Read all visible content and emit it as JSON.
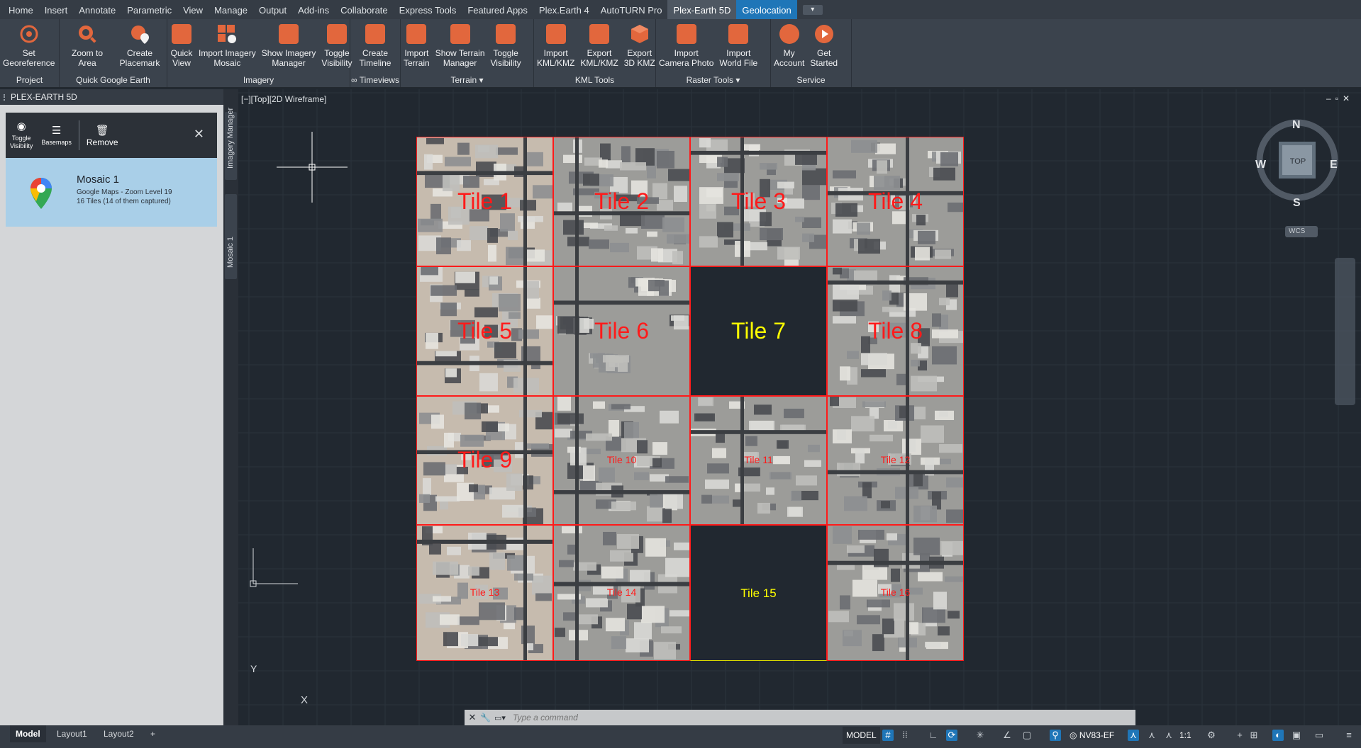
{
  "ribbon_tabs": [
    "Home",
    "Insert",
    "Annotate",
    "Parametric",
    "View",
    "Manage",
    "Output",
    "Add-ins",
    "Collaborate",
    "Express Tools",
    "Featured Apps",
    "Plex.Earth 4",
    "AutoTURN Pro",
    "Plex-Earth 5D",
    "Geolocation"
  ],
  "active_tab": "Plex-Earth 5D",
  "ribbon": {
    "project": {
      "title": "Project",
      "buttons": [
        "Set\nGeoreference"
      ]
    },
    "quick_google_earth": {
      "title": "Quick Google Earth",
      "buttons": [
        "Zoom to\nArea",
        "Create\nPlacemark"
      ]
    },
    "imagery": {
      "title": "Imagery",
      "buttons": [
        "Quick\nView",
        "Import Imagery\nMosaic",
        "Show Imagery\nManager",
        "Toggle\nVisibility"
      ]
    },
    "timeviews": {
      "title": "∞ Timeviews",
      "buttons": [
        "Create\nTimeline"
      ]
    },
    "terrain": {
      "title": "Terrain",
      "buttons": [
        "Import\nTerrain",
        "Show Terrain\nManager",
        "Toggle\nVisibility"
      ]
    },
    "kml_tools": {
      "title": "KML Tools",
      "buttons": [
        "Import\nKML/KMZ",
        "Export\nKML/KMZ",
        "Export\n3D KMZ"
      ]
    },
    "raster_tools": {
      "title": "Raster Tools",
      "buttons": [
        "Import\nCamera Photo",
        "Import\nWorld File"
      ]
    },
    "service": {
      "title": "Service",
      "buttons": [
        "My\nAccount",
        "Get\nStarted"
      ]
    }
  },
  "palette": {
    "title": "PLEX-EARTH 5D",
    "toolbar": {
      "toggle": "Toggle\nVisibility",
      "basemaps": "Basemaps",
      "remove": "Remove"
    },
    "mosaic": {
      "name": "Mosaic 1",
      "source": "Google Maps - Zoom Level 19",
      "tiles": "16 Tiles (14 of them captured)"
    },
    "side_tabs": [
      "Imagery Manager",
      "Mosaic 1"
    ]
  },
  "viewport": {
    "label": "[−][Top][2D Wireframe]",
    "tiles": [
      {
        "label": "Tile 1",
        "captured": true,
        "size": "large"
      },
      {
        "label": "Tile 2",
        "captured": true,
        "size": "large"
      },
      {
        "label": "Tile 3",
        "captured": true,
        "size": "large"
      },
      {
        "label": "Tile 4",
        "captured": true,
        "size": "large"
      },
      {
        "label": "Tile 5",
        "captured": true,
        "size": "large"
      },
      {
        "label": "Tile 6",
        "captured": true,
        "size": "large"
      },
      {
        "label": "Tile 7",
        "captured": false,
        "size": "large"
      },
      {
        "label": "Tile 8",
        "captured": true,
        "size": "large"
      },
      {
        "label": "Tile 9",
        "captured": true,
        "size": "large"
      },
      {
        "label": "Tile 10",
        "captured": true,
        "size": "small"
      },
      {
        "label": "Tile 11",
        "captured": true,
        "size": "small"
      },
      {
        "label": "Tile 12",
        "captured": true,
        "size": "small"
      },
      {
        "label": "Tile 13",
        "captured": true,
        "size": "small"
      },
      {
        "label": "Tile 14",
        "captured": true,
        "size": "small"
      },
      {
        "label": "Tile 15",
        "captured": false,
        "size": "small"
      },
      {
        "label": "Tile 16",
        "captured": true,
        "size": "small"
      }
    ],
    "viewcube": {
      "n": "N",
      "s": "S",
      "e": "E",
      "w": "W",
      "top": "TOP",
      "wcs": "WCS"
    },
    "ucs": {
      "x": "X",
      "y": "Y"
    }
  },
  "command": {
    "placeholder": "Type a command"
  },
  "layouts": [
    "Model",
    "Layout1",
    "Layout2"
  ],
  "status": {
    "model": "MODEL",
    "coord": "NV83-EF",
    "scale": "1:1"
  },
  "colors": {
    "tile_border": "#ff1a1a",
    "tile_label_red": "#ff1a1a",
    "tile_label_yellow": "#ffff00",
    "accent_blue": "#1f76b8",
    "ribbon_orange": "#e2673d"
  }
}
